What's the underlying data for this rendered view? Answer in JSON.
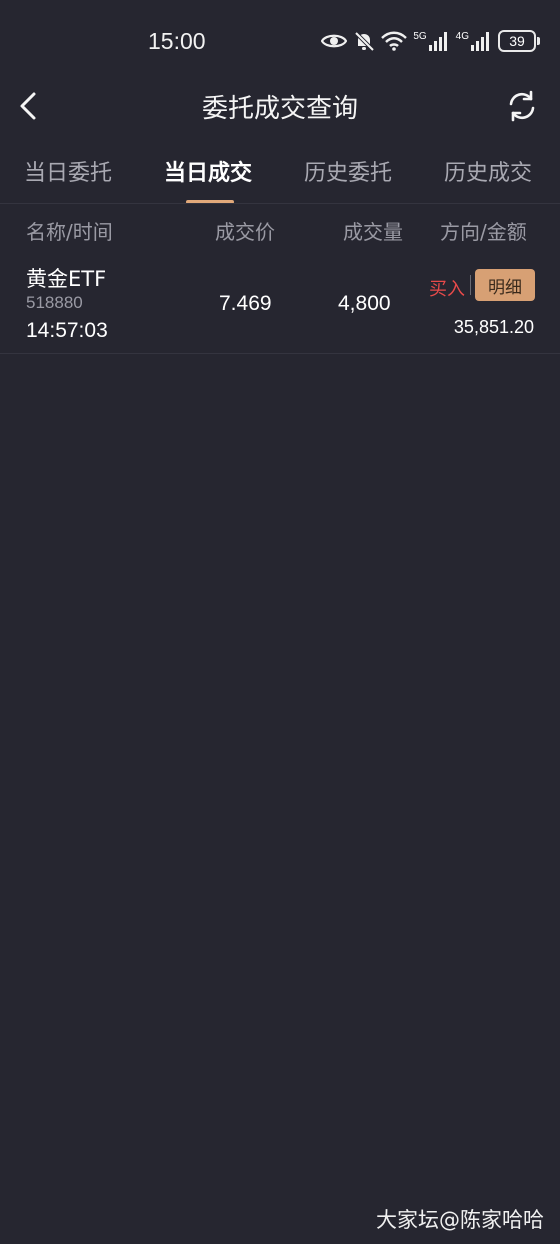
{
  "status_bar": {
    "time": "15:00",
    "network_5g": "5G",
    "network_4g": "4G",
    "battery": "39",
    "icons": [
      "eye-icon",
      "bell-muted-icon",
      "wifi-icon",
      "signal-5g-icon",
      "signal-4g-icon",
      "battery-icon"
    ]
  },
  "header": {
    "title": "委托成交查询",
    "back_icon": "chevron-left-icon",
    "refresh_icon": "refresh-icon"
  },
  "tabs": [
    {
      "label": "当日委托",
      "active": false
    },
    {
      "label": "当日成交",
      "active": true
    },
    {
      "label": "历史委托",
      "active": false
    },
    {
      "label": "历史成交",
      "active": false
    }
  ],
  "table": {
    "columns": [
      "名称/时间",
      "成交价",
      "成交量",
      "方向/金额"
    ],
    "rows": [
      {
        "name": "黄金ETF",
        "code": "518880",
        "time": "14:57:03",
        "price": "7.469",
        "quantity": "4,800",
        "direction": "买入",
        "detail_label": "明细",
        "amount": "35,851.20"
      }
    ]
  },
  "colors": {
    "background": "#262630",
    "accent": "#d7a074",
    "buy": "#e84a4a"
  },
  "watermark": "大家坛@陈家哈哈"
}
